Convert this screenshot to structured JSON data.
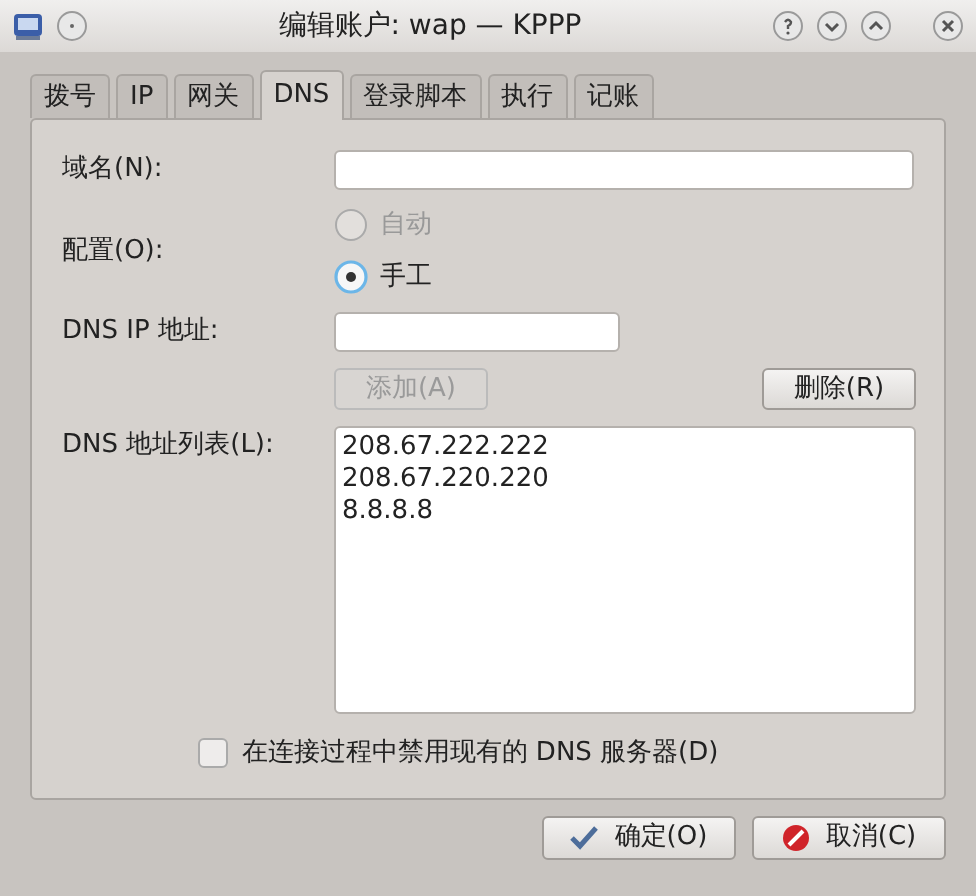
{
  "window": {
    "title": "编辑账户: wap — KPPP"
  },
  "tabs": [
    {
      "label": "拨号",
      "selected": false
    },
    {
      "label": "IP",
      "selected": false
    },
    {
      "label": "网关",
      "selected": false
    },
    {
      "label": "DNS",
      "selected": true
    },
    {
      "label": "登录脚本",
      "selected": false
    },
    {
      "label": "执行",
      "selected": false
    },
    {
      "label": "记账",
      "selected": false
    }
  ],
  "domain": {
    "label": "域名(N):"
  },
  "config": {
    "label": "配置(O):",
    "options": [
      {
        "label": "自动",
        "selected": false,
        "disabled": true
      },
      {
        "label": "手工",
        "selected": true,
        "disabled": false
      }
    ]
  },
  "dns_ip": {
    "label": "DNS IP 地址:"
  },
  "add_button": {
    "label": "添加(A)",
    "disabled": true
  },
  "remove_button": {
    "label": "删除(R)",
    "disabled": false
  },
  "dns_list": {
    "label": "DNS 地址列表(L):",
    "items": [
      "208.67.222.222",
      "208.67.220.220",
      "8.8.8.8"
    ]
  },
  "disable_existing": {
    "label": "在连接过程中禁用现有的 DNS 服务器(D)",
    "checked": false
  },
  "buttons": [
    {
      "label": "确定(O)",
      "kind": "ok"
    },
    {
      "label": "取消(C)",
      "kind": "cancel"
    }
  ]
}
